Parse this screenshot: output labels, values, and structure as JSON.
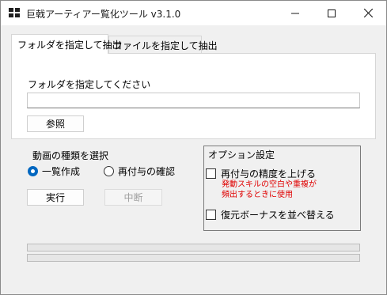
{
  "window": {
    "title": "巨戟アーティアー覧化ツール v3.1.0"
  },
  "icons": {
    "app": "app-grid-icon",
    "minimize": "minimize-icon",
    "maximize": "maximize-icon",
    "close": "close-icon"
  },
  "tabs": [
    {
      "label": "フォルダを指定して抽出",
      "active": true
    },
    {
      "label": "ファイルを指定して抽出",
      "active": false
    }
  ],
  "folder": {
    "label": "フォルダを指定してください",
    "value": "",
    "browse_label": "参照"
  },
  "video_type": {
    "label": "動画の種類を選択",
    "options": [
      {
        "label": "一覧作成",
        "checked": true
      },
      {
        "label": "再付与の確認",
        "checked": false
      }
    ]
  },
  "actions": {
    "run_label": "実行",
    "stop_label": "中断",
    "stop_enabled": false
  },
  "options": {
    "title": "オプション設定",
    "precision": {
      "label": "再付与の精度を上げる",
      "checked": false,
      "note_lines": [
        "発動スキルの空白や重複が",
        "頻出するときに使用"
      ]
    },
    "sort_bonus": {
      "label": "復元ボーナスを並べ替える",
      "checked": false
    }
  },
  "progress": [
    {
      "value": 0
    },
    {
      "value": 0
    }
  ],
  "colors": {
    "accent": "#0067c0",
    "note": "#e00000",
    "progress_fill": "#06b025",
    "background": "#f0f0f0"
  }
}
